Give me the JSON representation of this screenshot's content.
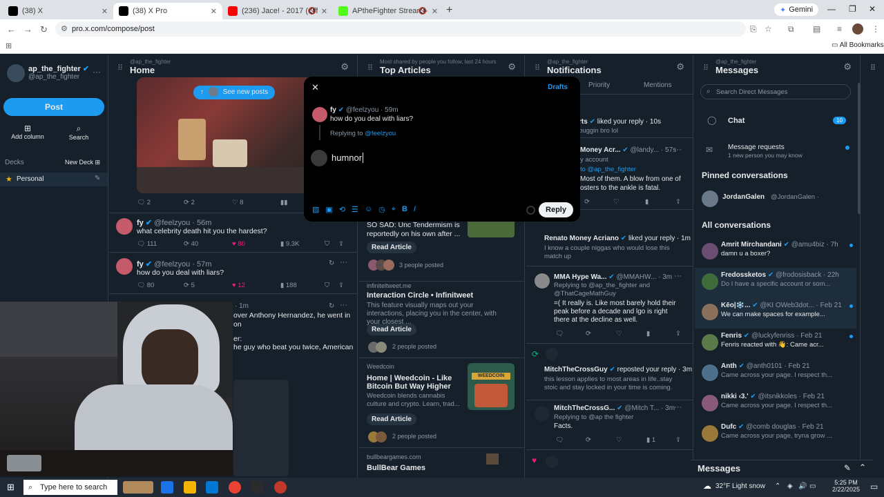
{
  "browser": {
    "tabs": [
      {
        "label": "(38) X",
        "active": false,
        "color": "#000000"
      },
      {
        "label": "(38) X Pro",
        "active": true,
        "color": "#000000"
      },
      {
        "label": "(236) Jace! - 2017 (Official Vi",
        "active": false,
        "color": "#ff0000"
      },
      {
        "label": "APtheFighter Stream - Wat",
        "active": false,
        "color": "#53fc18"
      }
    ],
    "gemini_label": "Gemini",
    "url": "pro.x.com/compose/post",
    "all_bookmarks": "All Bookmarks"
  },
  "sidebar": {
    "username": "ap_the_fighter",
    "handle": "@ap_the_fighter",
    "post_label": "Post",
    "add_column_label": "Add column",
    "search_label": "Search",
    "decks_label": "Decks",
    "new_deck_label": "New Deck",
    "deck_name": "Personal"
  },
  "columns": {
    "home": {
      "sub": "@ap_the_fighter",
      "title": "Home"
    },
    "articles": {
      "sub": "Most shared by people you follow, last 24 hours",
      "title": "Top Articles"
    },
    "notifications": {
      "sub": "@ap_the_fighter",
      "title": "Notifications"
    },
    "messages": {
      "sub": "@ap_the_fighter",
      "title": "Messages"
    }
  },
  "home": {
    "see_new_posts": "See new posts",
    "first_actions": {
      "replies": "2",
      "reposts": "2",
      "likes": "8"
    },
    "posts": [
      {
        "name": "fy",
        "handle": "@feelzyou · 56m",
        "text": "what celebrity death hit you the hardest?",
        "replies": "111",
        "reposts": "40",
        "likes": "80",
        "views": "9.3K"
      },
      {
        "name": "fy",
        "handle": "@feelzyou · 57m",
        "text": "how do you deal with liars?",
        "replies": "80",
        "reposts": "5",
        "likes": "12",
        "views": "188"
      }
    ],
    "partial_time": "· 1m",
    "partial_line1": "over Anthony Hernandez, he went in on",
    "partial_line2": "er:",
    "partial_line3": "he guy who beat you twice, American"
  },
  "articles": {
    "items": [
      {
        "source": "",
        "title": "",
        "text": "SO SAD: Unc Tendermism is reportedly on his own after ...",
        "read": "Read Article",
        "posted": "3 people posted"
      },
      {
        "source": "infiniteltweet.me",
        "title": "Interaction Circle • Infinitweet",
        "text": "This feature visually maps out your interactions, placing you in the center, with your closest ...",
        "read": "Read Article",
        "posted": "2 people posted"
      },
      {
        "source": "Weedcoin",
        "title": "Home | Weedcoin - Like Bitcoin But Way Higher",
        "text": "Weedcoin blends cannabis culture and crypto. Learn, trad...",
        "read": "Read Article",
        "posted": "2 people posted",
        "thumb_text": "WEEDCOIN"
      },
      {
        "source": "bullbeargames.com",
        "title": "BullBear Games",
        "text": "",
        "read": "",
        "posted": ""
      }
    ]
  },
  "notifications": {
    "tabs": [
      "Priority",
      "Mentions"
    ],
    "items": [
      {
        "name": "rts",
        "action": "liked your reply · 10s",
        "text": "buggin bro lol"
      },
      {
        "name": "Money Acr...",
        "handle": "@landy... · 57s",
        "text_a": "y account",
        "text_b": "to @ap_the_fighter",
        "text_c": "Most of them. A blow from one of",
        "text_d": "osters to the ankle is fatal."
      },
      {
        "name": "Renato Money Acriano",
        "action": "liked your reply · 1m",
        "text": "I know a couple niggas who would lose this match up"
      },
      {
        "name": "MMA Hype Wa...",
        "handle": "@MMAHW... · 3m",
        "reply_to": "Replying to @ap_the_fighter and @ThatCageMathGuy",
        "text": "=( It really is. Like most barely hold their peak before a decade and lgo is right there at the decline as well."
      },
      {
        "name": "MitchTheCrossGuy",
        "action": "reposted your reply · 3m",
        "text": "this lesson applies to most areas in life..stay stoic and stay locked in your time is coming."
      },
      {
        "name": "MitchTheCrossG...",
        "handle": "@Mitch T... · 3m",
        "reply_to": "Replying to @ap the fighter",
        "text": "Facts.",
        "views": "1"
      }
    ]
  },
  "messages": {
    "search_placeholder": "Search Direct Messages",
    "chat_label": "Chat",
    "chat_badge": "10",
    "requests_label": "Message requests",
    "requests_sub": "1 new person you may know",
    "pinned_label": "Pinned conversations",
    "pinned": [
      {
        "name": "JordanGalen",
        "handle": "@JordanGalen ·"
      }
    ],
    "all_label": "All conversations",
    "conversations": [
      {
        "name": "Amrit Mirchandani",
        "handle": "@amu4biz · 7h",
        "text": "damn u a boxer?",
        "unread": true,
        "color": "#6b4e71"
      },
      {
        "name": "Fredossketos",
        "handle": "@frodosisback · 22h",
        "text": "Do I have a specific account or som...",
        "unread": false,
        "color": "#3e6b3a"
      },
      {
        "name": "Kēo|❄️...",
        "handle": "@KI OWeb3dot... · Feb 21",
        "text": "We can make spaces for example...",
        "unread": true,
        "color": "#8a6f5a"
      },
      {
        "name": "Fenris",
        "handle": "@luckyfenriss · Feb 21",
        "text": "Fenris reacted with 👋: Came acr...",
        "unread": true,
        "color": "#5a7a4a"
      },
      {
        "name": "Anth",
        "handle": "@anth0101 · Feb 21",
        "text": "Came across your page. I respect th...",
        "unread": false,
        "color": "#4d6f8a"
      },
      {
        "name": "nikki ‹3.'",
        "handle": "@itsnikkoles · Feb 21",
        "text": "Came across your page. I respect th...",
        "unread": false,
        "color": "#8a5a7a"
      },
      {
        "name": "Dufc",
        "handle": "@comb douglas · Feb 21",
        "text": "Came across your page, tryna grow ...",
        "unread": false,
        "color": "#9a7a3a"
      }
    ],
    "bar_label": "Messages"
  },
  "compose": {
    "drafts_label": "Drafts",
    "orig_name": "fy",
    "orig_handle": "@feelzyou · 59m",
    "orig_text": "how do you deal with liars?",
    "replying_prefix": "Replying to",
    "replying_handle": "@feelzyou",
    "draft_text": "humnor",
    "reply_label": "Reply"
  },
  "taskbar": {
    "search_placeholder": "Type here to search",
    "weather": "32°F Light snow",
    "time": "5:25 PM",
    "date": "2/22/2025"
  }
}
